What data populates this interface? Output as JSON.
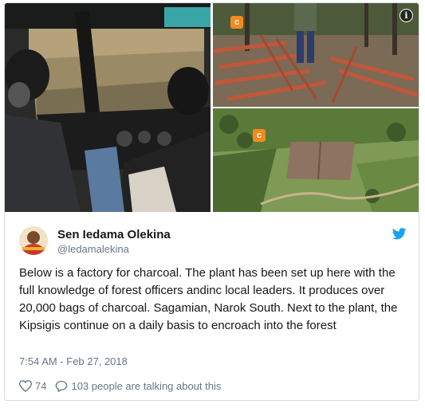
{
  "tweet": {
    "author_name": "Sen Iedama Olekina",
    "author_handle": "@ledamalekina",
    "text": "Below is a factory for charcoal. The plant has been set up here with the full knowledge of forest officers andinc local leaders. It produces over 20,000 bags of charcoal. Sagamian, Narok South. Next to the plant, the Kipsigis continue on a daily basis to encroach into the forest",
    "timestamp": "7:54 AM - Feb 27, 2018",
    "like_count": "74",
    "talking_about": "103 people are talking about this"
  },
  "media": {
    "info_glyph": "i",
    "badge_glyph": "c"
  },
  "icons": {
    "brand": "twitter-bird-icon",
    "like": "heart-icon",
    "reply": "speech-bubble-icon",
    "info": "info-icon"
  },
  "colors": {
    "twitter_blue": "#1da1f2",
    "text": "#14171a",
    "secondary_text": "#657786",
    "badge_orange": "#f28a1e"
  }
}
